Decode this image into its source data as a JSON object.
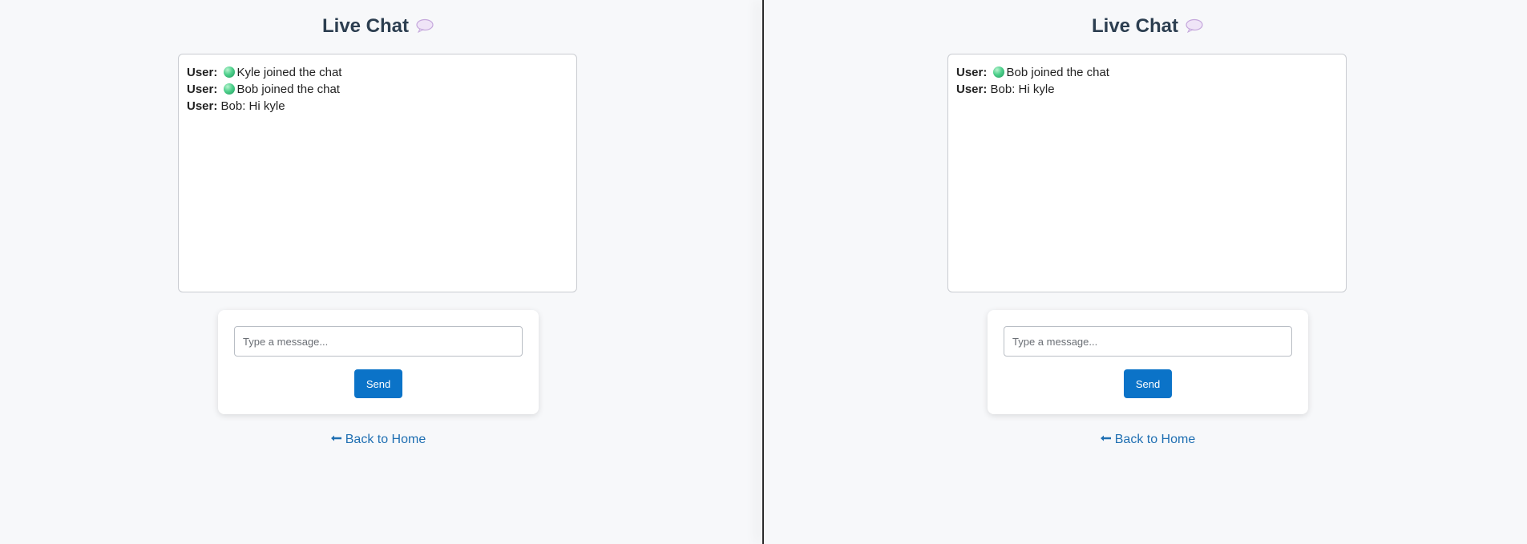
{
  "panes": [
    {
      "title": "Live Chat",
      "title_icon": "speech-bubble-icon",
      "messages": [
        {
          "who": "User:",
          "status_icon": "green-dot-icon",
          "text": "Kyle joined the chat"
        },
        {
          "who": "User:",
          "status_icon": "green-dot-icon",
          "text": "Bob joined the chat"
        },
        {
          "who": "User:",
          "status_icon": null,
          "text": "Bob: Hi kyle"
        }
      ],
      "input": {
        "placeholder": "Type a message...",
        "value": ""
      },
      "send_label": "Send",
      "back_label": "Back to Home",
      "back_icon": "arrow-left-icon"
    },
    {
      "title": "Live Chat",
      "title_icon": "speech-bubble-icon",
      "messages": [
        {
          "who": "User:",
          "status_icon": "green-dot-icon",
          "text": "Bob joined the chat"
        },
        {
          "who": "User:",
          "status_icon": null,
          "text": "Bob: Hi kyle"
        }
      ],
      "input": {
        "placeholder": "Type a message...",
        "value": ""
      },
      "send_label": "Send",
      "back_label": "Back to Home",
      "back_icon": "arrow-left-icon"
    }
  ],
  "colors": {
    "background": "#f7f8fa",
    "title": "#2c3e50",
    "send_button": "#0b73c8",
    "link": "#1f6fb2",
    "status_dot": "#4fd08c"
  }
}
